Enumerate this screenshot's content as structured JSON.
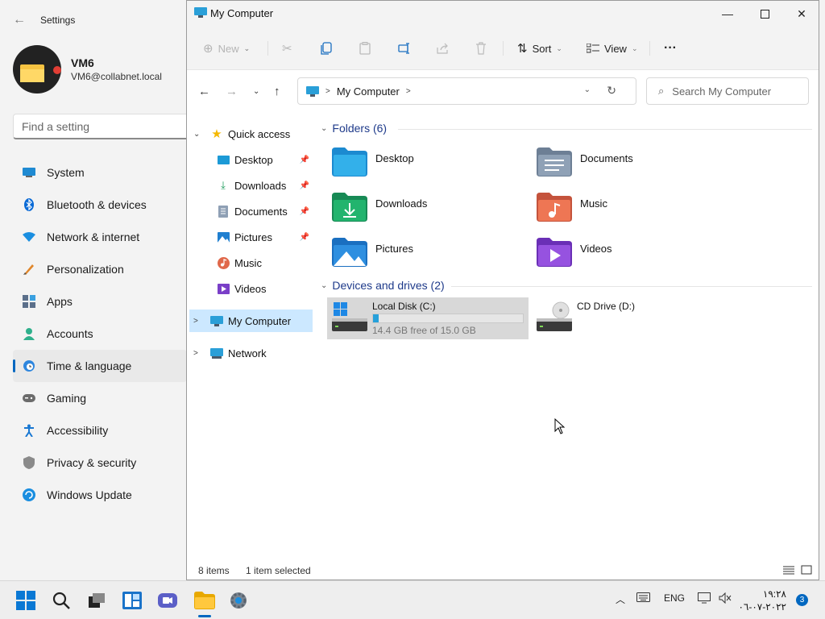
{
  "settings": {
    "title": "Settings",
    "user": {
      "name": "VM6",
      "email": "VM6@collabnet.local"
    },
    "search_placeholder": "Find a setting",
    "nav": [
      {
        "label": "System",
        "icon": "monitor-icon"
      },
      {
        "label": "Bluetooth & devices",
        "icon": "bluetooth-icon"
      },
      {
        "label": "Network & internet",
        "icon": "wifi-icon"
      },
      {
        "label": "Personalization",
        "icon": "brush-icon"
      },
      {
        "label": "Apps",
        "icon": "apps-icon"
      },
      {
        "label": "Accounts",
        "icon": "person-icon"
      },
      {
        "label": "Time & language",
        "icon": "globe-clock-icon",
        "active": true
      },
      {
        "label": "Gaming",
        "icon": "gamepad-icon"
      },
      {
        "label": "Accessibility",
        "icon": "accessibility-icon"
      },
      {
        "label": "Privacy & security",
        "icon": "shield-icon"
      },
      {
        "label": "Windows Update",
        "icon": "update-icon"
      }
    ]
  },
  "explorer": {
    "title": "My Computer",
    "toolbar": {
      "new": "New",
      "sort": "Sort",
      "view": "View",
      "more": "···"
    },
    "breadcrumb": [
      "My Computer"
    ],
    "search_placeholder": "Search My Computer",
    "tree": {
      "quick_access": "Quick access",
      "pinned": [
        "Desktop",
        "Downloads",
        "Documents",
        "Pictures"
      ],
      "others": [
        "Music",
        "Videos"
      ],
      "my_computer": "My Computer",
      "network": "Network"
    },
    "folders_header": "Folders (6)",
    "folders": [
      "Desktop",
      "Documents",
      "Downloads",
      "Music",
      "Pictures",
      "Videos"
    ],
    "drives_header": "Devices and drives (2)",
    "drives": [
      {
        "name": "Local Disk (C:)",
        "free": "14.4 GB free of 15.0 GB",
        "used_fraction": 0.04,
        "selected": true
      },
      {
        "name": "CD Drive (D:)"
      }
    ],
    "status": {
      "items": "8 items",
      "selected": "1 item selected"
    }
  },
  "taskbar": {
    "lang": "ENG",
    "time": "١٩:٢٨",
    "date": "٢٠٢٢-٠٧-٠٦",
    "notifications": "3"
  },
  "colors": {
    "accent": "#0067c0",
    "selection": "#cce8ff",
    "folder_header": "#1e3a8a"
  }
}
